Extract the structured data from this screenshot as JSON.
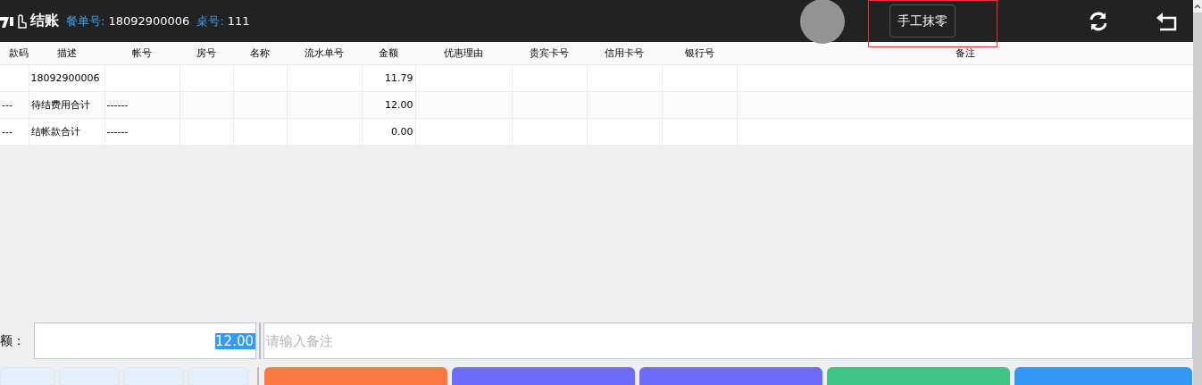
{
  "header": {
    "title": "结账",
    "order_label": "餐单号:",
    "order_no": "18092900006",
    "table_label": "桌号:",
    "table_no": "111",
    "round_off_button": {
      "label": "手工抹零",
      "highlighted": true
    }
  },
  "table": {
    "columns": [
      "款码",
      "描述",
      "帐号",
      "房号",
      "名称",
      "流水单号",
      "金额",
      "优惠理由",
      "贵宾卡号",
      "信用卡号",
      "银行号",
      "备注"
    ],
    "rows": [
      [
        "",
        "18092900006",
        "",
        "",
        "",
        "",
        "11.79",
        "",
        "",
        "",
        "",
        ""
      ],
      [
        "---",
        "待结费用合计",
        "------",
        "",
        "",
        "",
        "12.00",
        "",
        "",
        "",
        "",
        ""
      ],
      [
        "---",
        "结帐款合计",
        "------",
        "",
        "",
        "",
        "0.00",
        "",
        "",
        "",
        "",
        ""
      ]
    ]
  },
  "amount": {
    "label": "额：",
    "value": "12.00",
    "selected": true
  },
  "remark": {
    "placeholder": "请输入备注"
  },
  "keypad_buttons": [
    {
      "kind": "key"
    },
    {
      "kind": "key"
    },
    {
      "kind": "key"
    },
    {
      "kind": "key"
    }
  ],
  "action_buttons": [
    {
      "color": "#ff7843"
    },
    {
      "color": "#6c6cff"
    },
    {
      "color": "#6c6cff"
    },
    {
      "color": "#40c486"
    },
    {
      "color": "#3398f5"
    }
  ]
}
